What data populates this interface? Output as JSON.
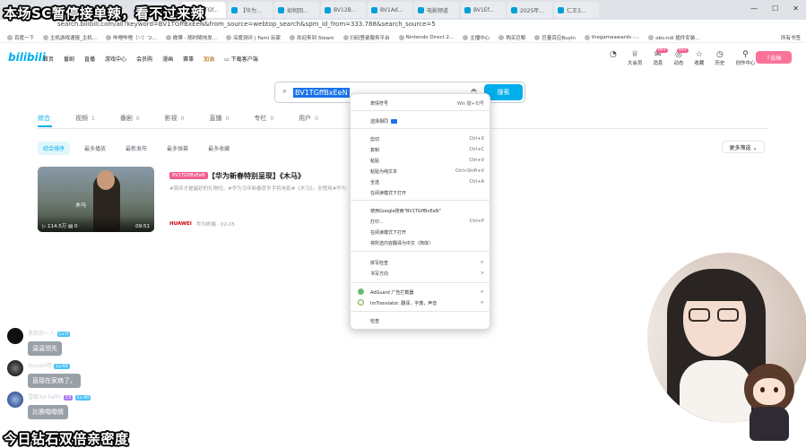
{
  "captions": {
    "top": "本场SC暂停接单辣，看不过来辣",
    "bottom": "今日钻石双倍亲密度"
  },
  "browser": {
    "tabs": [
      {
        "label": "首页"
      },
      {
        "label": "BV1TGf..."
      },
      {
        "label": "【华为..."
      },
      {
        "label": "如何回..."
      },
      {
        "label": "BV12B..."
      },
      {
        "label": "BV1Ad..."
      },
      {
        "label": "电影频道"
      },
      {
        "label": "BV1Ef..."
      },
      {
        "label": "2025年..."
      },
      {
        "label": "仁王3..."
      }
    ],
    "url": "search.bilibili.com/all?keyword=BV1TGffBxEeN&from_source=webtop_search&spm_id_from=333.788&search_source=5",
    "bookmarks": [
      "百度一下",
      "主机游戏速报_主机...",
      "哔哩哔哩（'-'）つ...",
      "微博 - 随时随地发...",
      "深度测评 | Fami 玩家",
      "欢迎来到 Steam",
      "扫码登录服务平台",
      "Nintendo Direct 2...",
      "主播中心",
      "购买巨鲸",
      "巨量百应Buyin",
      "thegameawards -...",
      "obs-ndi 插件安装..."
    ],
    "bookmarks_right": "所有书签"
  },
  "bili": {
    "logo": "bilibili",
    "nav": [
      "首页",
      "番剧",
      "直播",
      "游戏中心",
      "会员购",
      "漫画",
      "赛事"
    ],
    "nav_promo": "加油",
    "download": "下载客户端",
    "right_icons": [
      {
        "name": "avatar-icon",
        "label": "",
        "glyph": "◔"
      },
      {
        "name": "vip-icon",
        "label": "大会员",
        "glyph": "♕"
      },
      {
        "name": "message-icon",
        "label": "消息",
        "glyph": "✉",
        "badge": "99+"
      },
      {
        "name": "dynamic-icon",
        "label": "动态",
        "glyph": "◎",
        "badge": "99+"
      },
      {
        "name": "favorite-icon",
        "label": "收藏",
        "glyph": "☆"
      },
      {
        "name": "history-icon",
        "label": "历史",
        "glyph": "◷"
      },
      {
        "name": "creator-icon",
        "label": "创作中心",
        "glyph": "⚲"
      }
    ],
    "upload": "投稿"
  },
  "search": {
    "query": "BV1TGffBxEeN",
    "button": "搜索"
  },
  "result_tabs": [
    {
      "label": "综合",
      "count": ""
    },
    {
      "label": "视频",
      "count": "1"
    },
    {
      "label": "番剧",
      "count": "0"
    },
    {
      "label": "影视",
      "count": "0"
    },
    {
      "label": "直播",
      "count": "0"
    },
    {
      "label": "专栏",
      "count": "0"
    },
    {
      "label": "用户",
      "count": "0"
    }
  ],
  "sort_options": [
    "综合排序",
    "最多播放",
    "最新发布",
    "最多弹幕",
    "最多收藏"
  ],
  "more_filter": "更多筛选 ⌄",
  "video": {
    "tag": "BV1TGffBxEeN",
    "title": "【华为新春特别呈现】《木马》",
    "desc": "#简评才是最好的礼物吗，#华为马年新春贺岁手机电影#《木马》，全程用#华为",
    "views": "114.5万",
    "danmaku": "0",
    "duration": "09:51",
    "watermark": "木马",
    "uploader_brand": "HUAWEI",
    "uploader": "华为终端 · 02-05"
  },
  "context_menu": {
    "items": [
      {
        "label": "表情符号",
        "shortcut": "Win 键+句号"
      },
      {
        "label": "选择相同",
        "shortcut": ""
      },
      {
        "label": "剪切",
        "shortcut": "Ctrl+X"
      },
      {
        "label": "复制",
        "shortcut": "Ctrl+C"
      },
      {
        "label": "粘贴",
        "shortcut": "Ctrl+V"
      },
      {
        "label": "粘贴为纯文本",
        "shortcut": "Ctrl+Shift+V"
      },
      {
        "label": "全选",
        "shortcut": "Ctrl+A"
      },
      {
        "label": "在阅读模式下打开",
        "shortcut": ""
      },
      {
        "label": "使用Google搜索\"BV1TGffBxEeN\"",
        "shortcut": ""
      },
      {
        "label": "打印...",
        "shortcut": "Ctrl+P"
      },
      {
        "label": "在阅读模式下打开",
        "shortcut": ""
      },
      {
        "label": "将所选内容翻译为中文（简体）",
        "shortcut": ""
      },
      {
        "label": "拼写检查",
        "shortcut": ">"
      },
      {
        "label": "书写方向",
        "shortcut": ">"
      },
      {
        "label": "AdGuard 广告拦截器",
        "shortcut": ">"
      },
      {
        "label": "ImTranslator: 翻译，字典，声音",
        "shortcut": ">"
      },
      {
        "label": "检查",
        "shortcut": ""
      }
    ]
  },
  "chat": [
    {
      "name": "柔软的一人",
      "level": "Lv.0",
      "message": "温温领先"
    },
    {
      "name": "Sixuan吧",
      "level": "Lv.43",
      "message": "直接在家病了。"
    },
    {
      "name": "雪糕Yui Faith",
      "level": "Lv.40",
      "extra": "23",
      "message": "比赛嘞嘞情"
    }
  ],
  "colors": {
    "accent": "#00aeec",
    "pink": "#fb7299",
    "selection": "#1a73e8"
  }
}
